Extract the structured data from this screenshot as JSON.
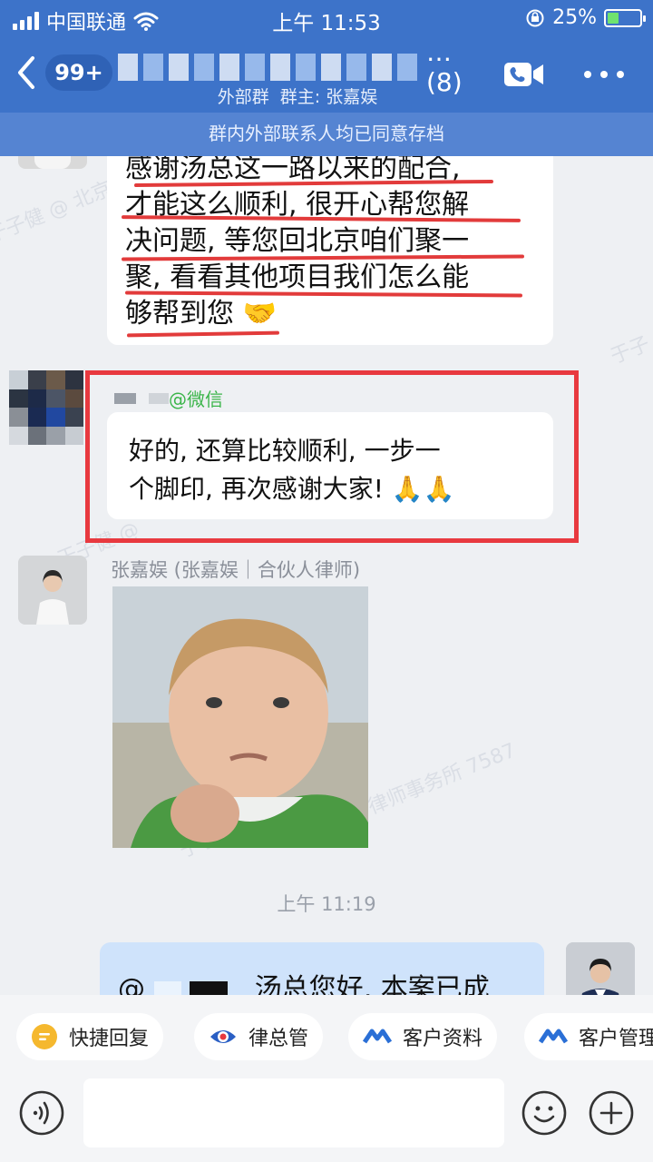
{
  "status_bar": {
    "carrier": "中国联通",
    "time": "上午 11:53",
    "battery": "25%"
  },
  "header": {
    "unread_badge": "99+",
    "group_count": "… (8)",
    "group_type": "外部群",
    "owner": "群主: 张嘉娱",
    "archive_notice": "群内外部联系人均已同意存档"
  },
  "messages": {
    "msg1": {
      "lines": [
        "感谢汤总这一路以来的配合,",
        "才能这么顺利, 很开心帮您解",
        "决问题, 等您回北京咱们聚一",
        "聚, 看看其他项目我们怎么能",
        "够帮到您 🤝"
      ]
    },
    "msg2": {
      "source": "@微信",
      "lines": [
        "好的, 还算比较顺利, 一步一",
        "个脚印, 再次感谢大家! 🙏🙏"
      ]
    },
    "msg3": {
      "sender": "张嘉娱 (张嘉娱｜合伙人律师)"
    },
    "time_separator": "上午 11:19",
    "msg4": {
      "prefix": "@",
      "text": "汤总您好, 本案已成"
    }
  },
  "watermarks": [
    "于子健 @ 北京大",
    "于子",
    "于子健 @",
    "律师事务所 7587",
    "于子健"
  ],
  "quick_actions": [
    {
      "label": "快捷回复",
      "icon": "quick-reply-icon"
    },
    {
      "label": "律总管",
      "icon": "eye-logo-icon"
    },
    {
      "label": "客户资料",
      "icon": "customer-logo-icon"
    },
    {
      "label": "客户管理",
      "icon": "customer-logo-icon"
    }
  ],
  "colors": {
    "header": "#3d73c9",
    "highlight_box": "#e8393f",
    "wechat_tag": "#3bb54a",
    "own_bubble": "#cfe3fb"
  }
}
